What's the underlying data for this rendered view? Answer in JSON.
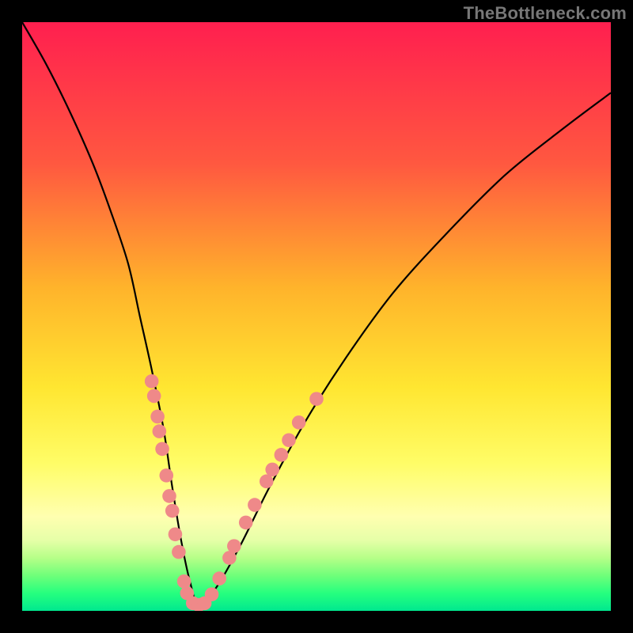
{
  "watermark": "TheBottleneck.com",
  "chart_data": {
    "type": "line",
    "title": "",
    "xlabel": "",
    "ylabel": "",
    "xlim": [
      0,
      100
    ],
    "ylim": [
      0,
      100
    ],
    "gradient_stops": [
      {
        "y_pct": 0,
        "color": "#ff1f4f"
      },
      {
        "y_pct": 24,
        "color": "#ff5840"
      },
      {
        "y_pct": 45,
        "color": "#ffb32b"
      },
      {
        "y_pct": 62,
        "color": "#ffe631"
      },
      {
        "y_pct": 75,
        "color": "#fffd67"
      },
      {
        "y_pct": 84,
        "color": "#ffffb0"
      },
      {
        "y_pct": 88,
        "color": "#e6ffa8"
      },
      {
        "y_pct": 91,
        "color": "#b6ff88"
      },
      {
        "y_pct": 94,
        "color": "#6fff7a"
      },
      {
        "y_pct": 97,
        "color": "#26ff7e"
      },
      {
        "y_pct": 100,
        "color": "#00e88f"
      }
    ],
    "series": [
      {
        "name": "bottleneck-curve",
        "x": [
          0,
          4,
          8,
          12,
          15,
          18,
          20,
          22,
          24,
          25.5,
          27,
          28.5,
          30,
          33,
          37,
          42,
          48,
          55,
          63,
          72,
          82,
          92,
          100
        ],
        "y": [
          100,
          93,
          85,
          76,
          68,
          59,
          50,
          41,
          31,
          21,
          12,
          5,
          1,
          4,
          11,
          21,
          32,
          43,
          54,
          64,
          74,
          82,
          88
        ]
      }
    ],
    "markers": [
      {
        "x": 22.0,
        "y": 39.0
      },
      {
        "x": 22.4,
        "y": 36.5
      },
      {
        "x": 23.0,
        "y": 33.0
      },
      {
        "x": 23.3,
        "y": 30.5
      },
      {
        "x": 23.8,
        "y": 27.5
      },
      {
        "x": 24.5,
        "y": 23.0
      },
      {
        "x": 25.0,
        "y": 19.5
      },
      {
        "x": 25.5,
        "y": 17.0
      },
      {
        "x": 26.0,
        "y": 13.0
      },
      {
        "x": 26.6,
        "y": 10.0
      },
      {
        "x": 27.5,
        "y": 5.0
      },
      {
        "x": 28.0,
        "y": 3.0
      },
      {
        "x": 29.0,
        "y": 1.3
      },
      {
        "x": 30.0,
        "y": 1.0
      },
      {
        "x": 31.0,
        "y": 1.3
      },
      {
        "x": 32.2,
        "y": 2.8
      },
      {
        "x": 33.5,
        "y": 5.5
      },
      {
        "x": 35.2,
        "y": 9.0
      },
      {
        "x": 36.0,
        "y": 11.0
      },
      {
        "x": 38.0,
        "y": 15.0
      },
      {
        "x": 39.5,
        "y": 18.0
      },
      {
        "x": 41.5,
        "y": 22.0
      },
      {
        "x": 42.5,
        "y": 24.0
      },
      {
        "x": 44.0,
        "y": 26.5
      },
      {
        "x": 45.3,
        "y": 29.0
      },
      {
        "x": 47.0,
        "y": 32.0
      },
      {
        "x": 50.0,
        "y": 36.0
      }
    ]
  }
}
